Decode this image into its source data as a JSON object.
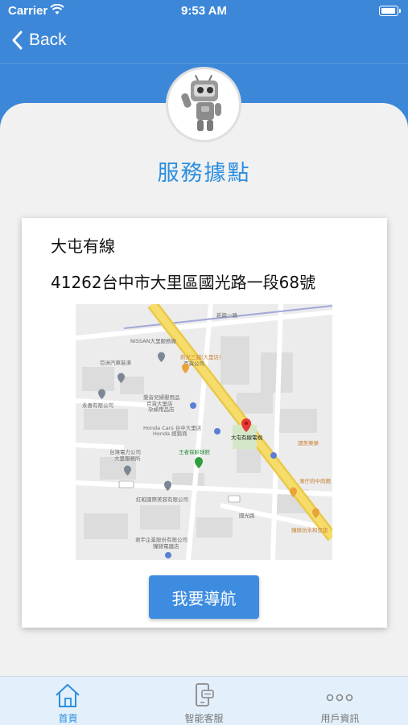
{
  "status_bar": {
    "carrier": "Carrier",
    "time": "9:53 AM"
  },
  "nav": {
    "back_label": "Back"
  },
  "page": {
    "title": "服務據點"
  },
  "location": {
    "name": "大屯有線",
    "address": "41262台中市大里區國光路一段68號",
    "navigate_button": "我要導航"
  },
  "map": {
    "labels": {
      "nissan": "NISSAN大里服務廠",
      "yazhou": "亞洲汽車裝潢",
      "yongxi": "永喜有限公司",
      "dazhong_rd": "新興一路",
      "shanlin": "新光三越(大里店)",
      "shanlin_sub": "百貨公司",
      "aiyin": "愛音兒婦嬰用品",
      "aiyin_sub": "百貨大里店",
      "aiyin_sub2": "孕婦用品店",
      "honda": "Honda Cars 台中大里店",
      "honda_sub": "Honda 經銷商",
      "datun": "大屯有線電視",
      "wangzhe": "王者保齡球館",
      "taipower": "台灣電力公司",
      "taipower_sub": "大里服務所",
      "hongyi": "紅粧國際美容有限公司",
      "zhengyu": "君宇企業股份有限公司",
      "zhengyu_sub": "鐘錶電器店",
      "hangang": "滙仔府中肉麵",
      "xiangmei": "讀美樂樂",
      "shop": "鐘錶坊永和豆漿",
      "road": "國光路"
    }
  },
  "tabs": [
    {
      "label": "首頁",
      "icon": "home-icon",
      "active": true
    },
    {
      "label": "智能客服",
      "icon": "chat-phone-icon",
      "active": false
    },
    {
      "label": "用戶資訊",
      "icon": "more-icon",
      "active": false
    }
  ],
  "colors": {
    "primary": "#3d87d8",
    "accent": "#2a8ee0",
    "background": "#f1f1f1",
    "tabbar": "#e3f0fc"
  }
}
